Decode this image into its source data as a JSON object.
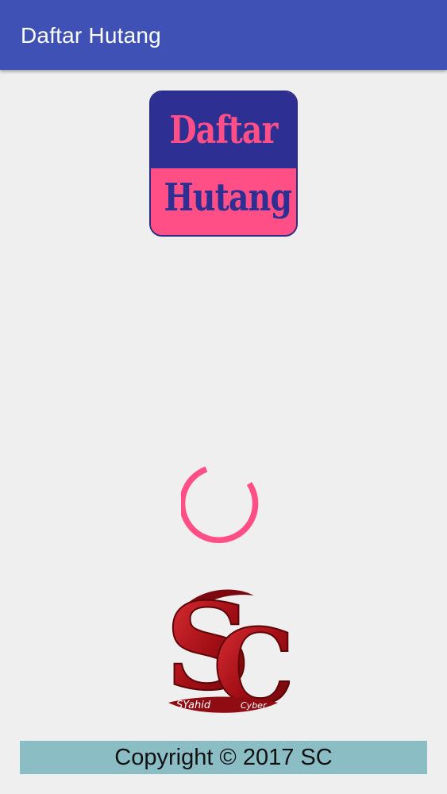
{
  "app_bar": {
    "title": "Daftar Hutang",
    "color": "#3f51b5"
  },
  "logo": {
    "line1": "Daftar",
    "line2": "Hutang",
    "top_color": "#2d3092",
    "bottom_color": "#ff4f86"
  },
  "spinner": {
    "icon": "loading-spinner-icon",
    "color": "#ff4f86"
  },
  "brand_logo": {
    "icon": "sc-logo",
    "letters": "SC",
    "left_text": "SYahid",
    "right_text": "Cyber",
    "color": "#b0141a"
  },
  "footer": {
    "text": "Copyright © 2017 SC",
    "background": "#8bbdc5"
  }
}
